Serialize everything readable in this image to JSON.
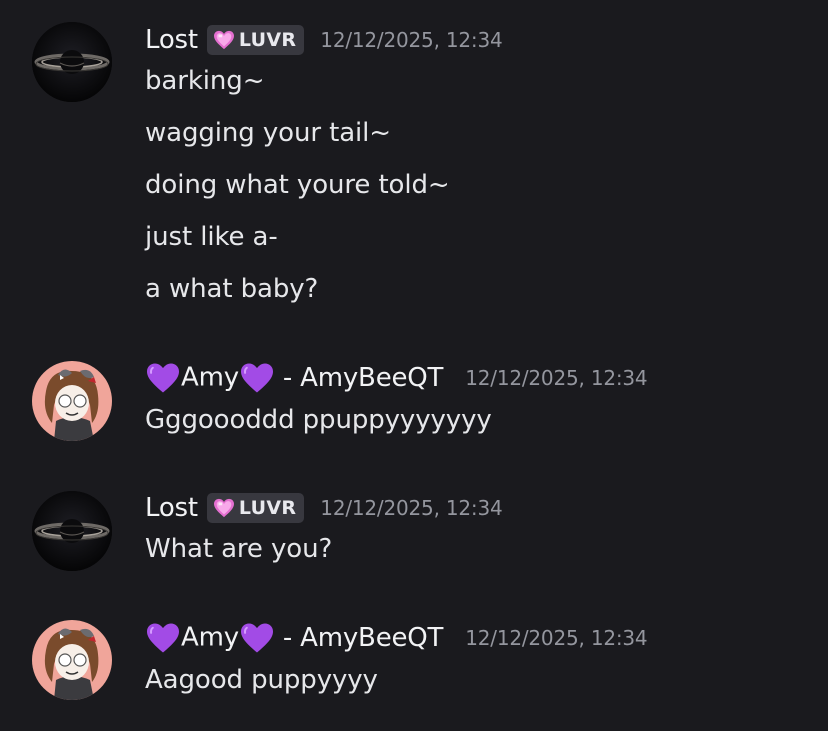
{
  "messages": [
    {
      "author": "Lost",
      "tag": "LUVR",
      "timestamp": "12/12/2025, 12:34",
      "lines": [
        "barking~",
        "wagging your tail~",
        "doing what youre told~",
        "just like a-",
        "a what baby?"
      ]
    },
    {
      "author_name": "Amy",
      "author_separator": "- AmyBeeQT",
      "timestamp": "12/12/2025, 12:34",
      "lines": [
        "Gggoooddd ppuppyyyyyyy"
      ]
    },
    {
      "author": "Lost",
      "tag": "LUVR",
      "timestamp": "12/12/2025, 12:34",
      "lines": [
        "What are you?"
      ]
    },
    {
      "author_name": "Amy",
      "author_separator": "- AmyBeeQT",
      "timestamp": "12/12/2025, 12:34",
      "lines": [
        "Aagood puppyyyy"
      ]
    }
  ],
  "icons": {
    "lost_avatar": "saturn-avatar",
    "amy_avatar": "anime-girl-avatar",
    "tag_icon": "pink-heart-gem-icon",
    "name_icon": "purple-heart-icon"
  },
  "colors": {
    "background": "#1a1a1e",
    "username": "#f2f3f5",
    "timestamp": "#94969e",
    "tag_bg": "#38383f",
    "purple_heart": "#a24be6",
    "pink_gem": "#f08ad8"
  }
}
